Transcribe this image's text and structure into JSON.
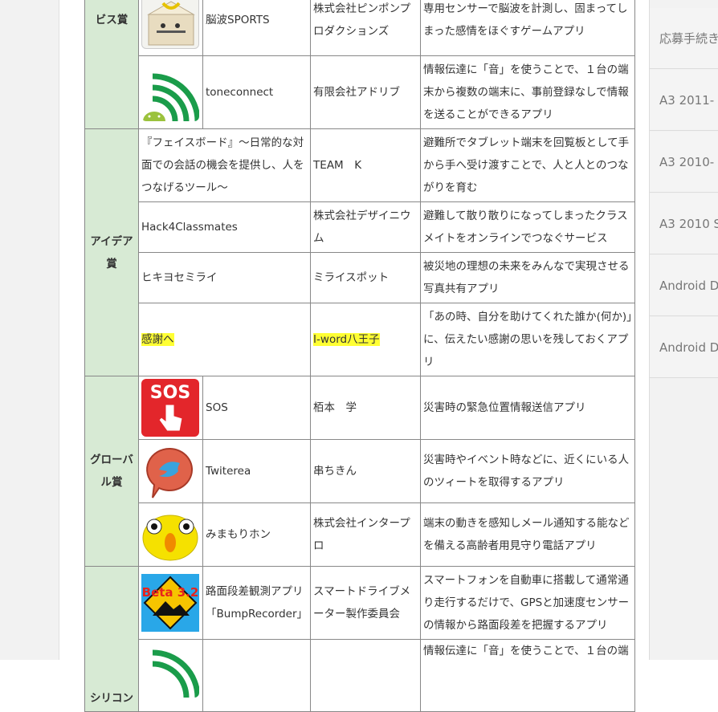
{
  "categories": {
    "service": "ビス賞",
    "idea": "アイデア賞",
    "global": "グローバル賞",
    "silicon": "シリコン"
  },
  "rows": [
    {
      "icon": "box-character-icon",
      "name": "脳波SPORTS",
      "org": "株式会社ピンポンプロダクションズ",
      "desc": "専用センサーで脳波を計測し、固まってしまった感情をほぐすゲームアプリ"
    },
    {
      "icon": "android-wave-icon",
      "name": "toneconnect",
      "org": "有限会社アドリブ",
      "desc": "情報伝達に「音」を使うことで、１台の端末から複数の端末に、事前登録なしで情報を送ることができるアプリ"
    },
    {
      "name": "『フェイスボード』～日常的な対面での会話の機会を提供し、人をつなげるツール～",
      "org": "TEAM　K",
      "desc": "避難所でタブレット端末を回覧板として手から手へ受け渡すことで、人と人とのつながりを育む"
    },
    {
      "name": "Hack4Classmates",
      "org": "株式会社デザイニウム",
      "desc": "避難して散り散りになってしまったクラスメイトをオンラインでつなぐサービス"
    },
    {
      "name": "ヒキヨセミライ",
      "org": "ミライスポット",
      "desc": "被災地の理想の未来をみんなで実現させる写真共有アプリ"
    },
    {
      "name": "感謝へ",
      "org": "I-word八王子",
      "desc": "「あの時、自分を助けてくれた誰か(何か)」に、伝えたい感謝の思いを残しておくアプリ",
      "highlight": true
    },
    {
      "icon": "sos-icon",
      "icon_text": "SOS",
      "name": "SOS",
      "org": "栢本　学",
      "desc": "災害時の緊急位置情報送信アプリ"
    },
    {
      "icon": "twitter-bird-icon",
      "name": "Twiterea",
      "org": "串ちきん",
      "desc": "災害時やイベント時などに、近くにいる人のツィートを取得するアプリ"
    },
    {
      "icon": "yellow-face-icon",
      "name": "みまもりホン",
      "org": "株式会社インタープロ",
      "desc": "端末の動きを感知しメール通知する能などを備える高齢者用見守り電話アプリ"
    },
    {
      "icon": "beta-sign-icon",
      "icon_text": "Beta 3.2",
      "name": "路面段差観測アプリ「BumpRecorder」",
      "org": "スマートドライブメーター製作委員会",
      "desc": "スマートフォンを自動車に搭載して通常通り走行するだけで、GPSと加速度センサーの情報から路面段差を把握するアプリ"
    },
    {
      "icon": "android-wave-icon",
      "name": "",
      "org": "",
      "desc": "情報伝達に「音」を使うことで、１台の端"
    }
  ],
  "sidebar": [
    "応募手続き",
    "A3 2011-",
    "A3 2010-",
    "A3 2010 S",
    "Android D",
    "Android D"
  ],
  "colors": {
    "category_bg": "#d7ead4",
    "highlight": "#ffff33",
    "sidebar_bg": "#f2f2f2"
  }
}
